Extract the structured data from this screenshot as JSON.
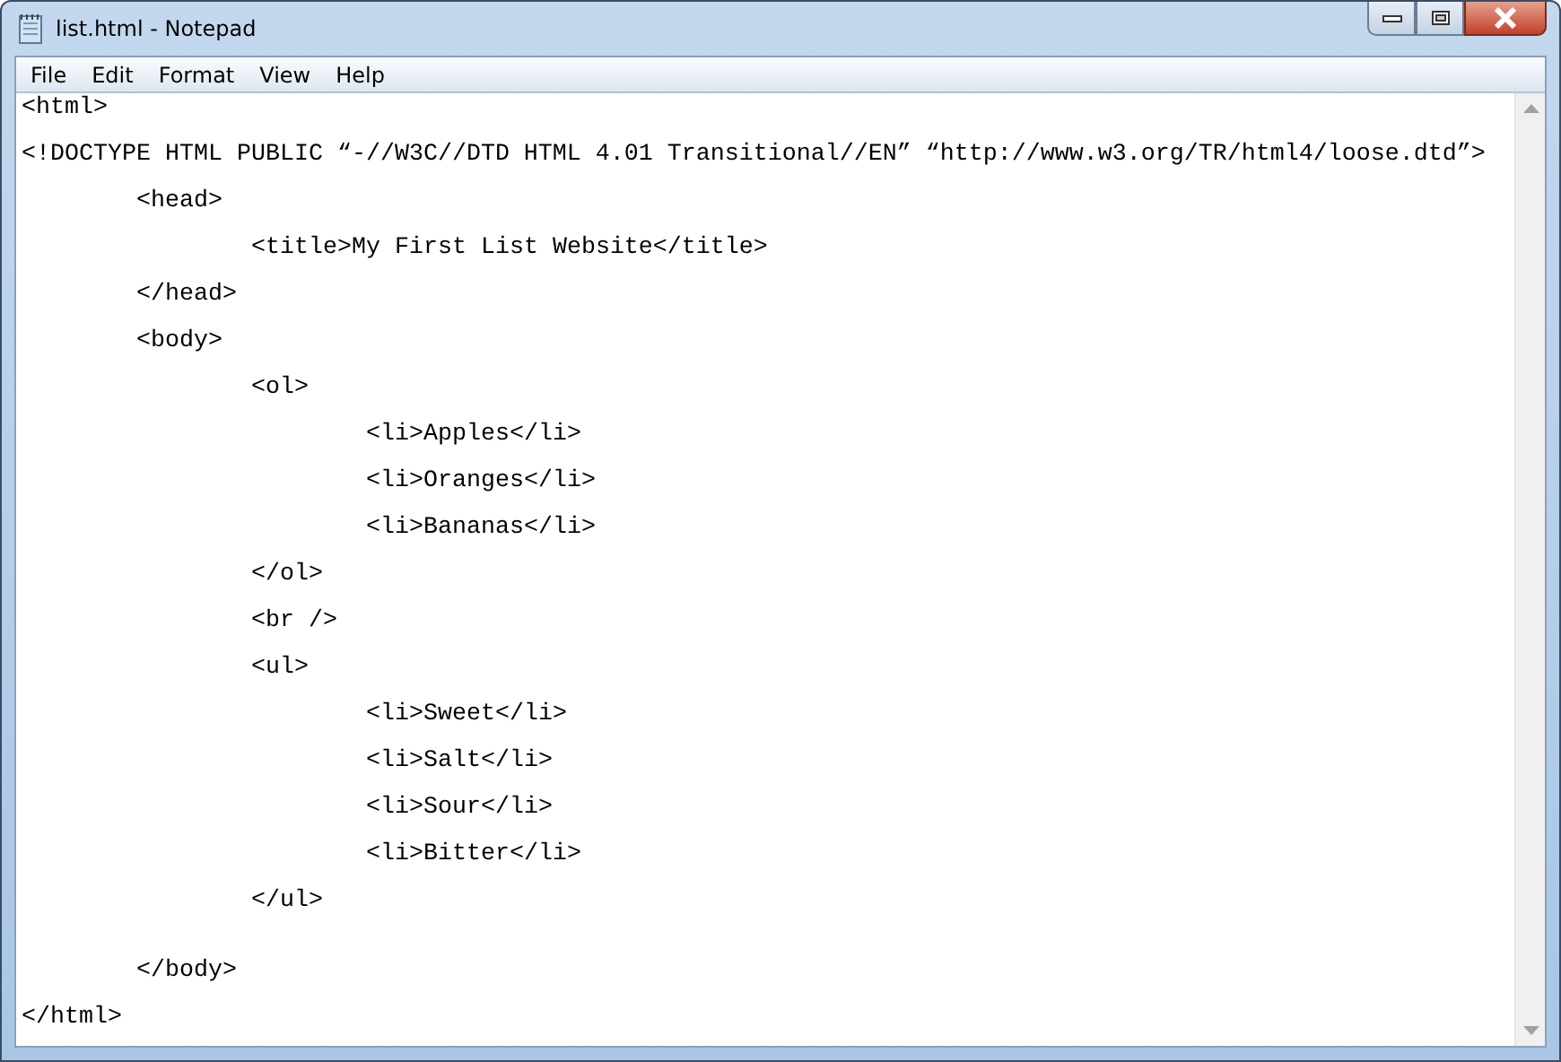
{
  "window": {
    "title": "list.html - Notepad"
  },
  "menu": [
    "File",
    "Edit",
    "Format",
    "View",
    "Help"
  ],
  "lines": [
    {
      "text": "<html>",
      "extra_space": false
    },
    {
      "text": "<!DOCTYPE HTML PUBLIC “-//W3C//DTD HTML 4.01 Transitional//EN” “http://www.w3.org/TR/html4/loose.dtd”>",
      "extra_space": false
    },
    {
      "text": "\t<head>",
      "extra_space": false
    },
    {
      "text": "\t\t<title>My First List Website</title>",
      "extra_space": false
    },
    {
      "text": "\t</head>",
      "extra_space": false
    },
    {
      "text": "\t<body>",
      "extra_space": false
    },
    {
      "text": "\t\t<ol>",
      "extra_space": false
    },
    {
      "text": "\t\t\t<li>Apples</li>",
      "extra_space": false
    },
    {
      "text": "\t\t\t<li>Oranges</li>",
      "extra_space": false
    },
    {
      "text": "\t\t\t<li>Bananas</li>",
      "extra_space": false
    },
    {
      "text": "\t\t</ol>",
      "extra_space": false
    },
    {
      "text": "\t\t<br />",
      "extra_space": false
    },
    {
      "text": "\t\t<ul>",
      "extra_space": false
    },
    {
      "text": "\t\t\t<li>Sweet</li>",
      "extra_space": false
    },
    {
      "text": "\t\t\t<li>Salt</li>",
      "extra_space": false
    },
    {
      "text": "\t\t\t<li>Sour</li>",
      "extra_space": false
    },
    {
      "text": "\t\t\t<li>Bitter</li>",
      "extra_space": false
    },
    {
      "text": "\t\t</ul>",
      "extra_space": false
    },
    {
      "text": "\t</body>",
      "extra_space": true
    },
    {
      "text": "</html>",
      "extra_space": false
    }
  ]
}
